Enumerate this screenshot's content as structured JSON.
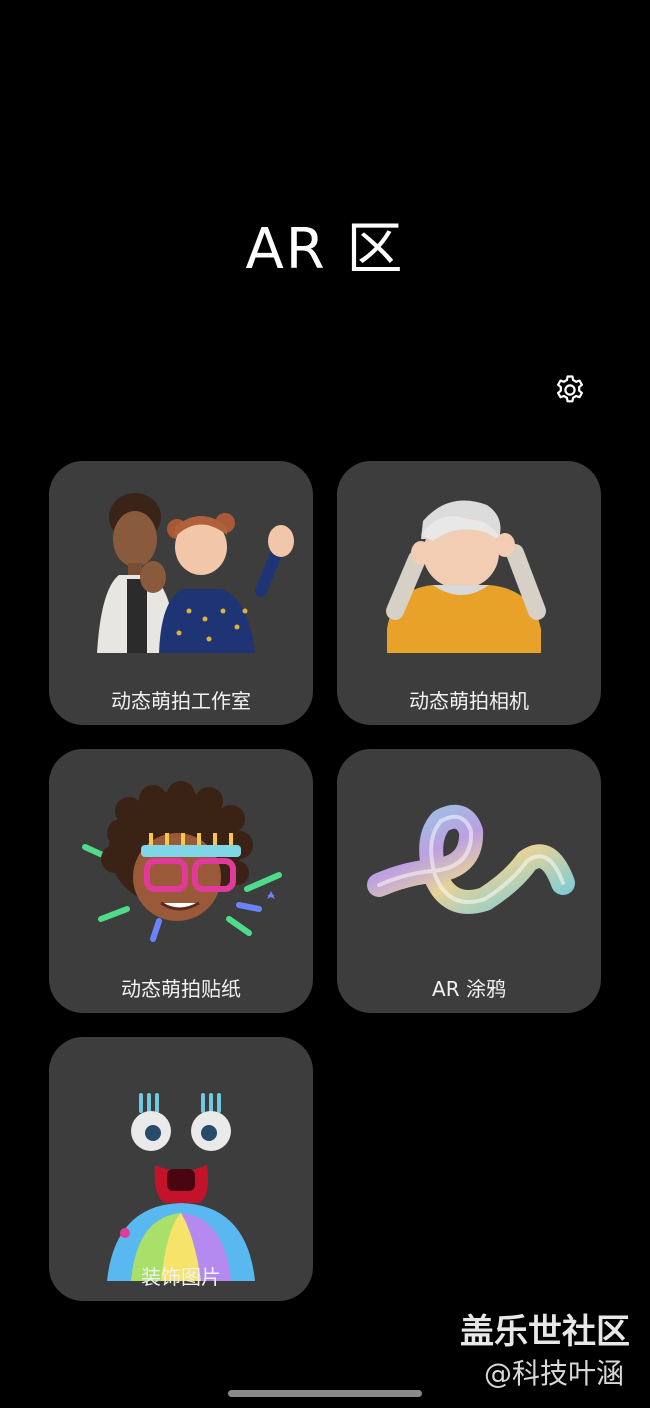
{
  "header": {
    "title": "AR 区"
  },
  "settings": {
    "icon": "gear-icon"
  },
  "tiles": [
    {
      "id": "studio",
      "label": "动态萌拍工作室"
    },
    {
      "id": "camera",
      "label": "动态萌拍相机"
    },
    {
      "id": "sticker",
      "label": "动态萌拍贴纸"
    },
    {
      "id": "doodle",
      "label": "AR 涂鸦"
    },
    {
      "id": "decor",
      "label": "装饰图片"
    }
  ],
  "watermark": {
    "line1": "盖乐世社区",
    "line2": "@科技叶涵"
  },
  "colors": {
    "background": "#000000",
    "tile": "#3d3d3d",
    "text": "#ffffff"
  }
}
